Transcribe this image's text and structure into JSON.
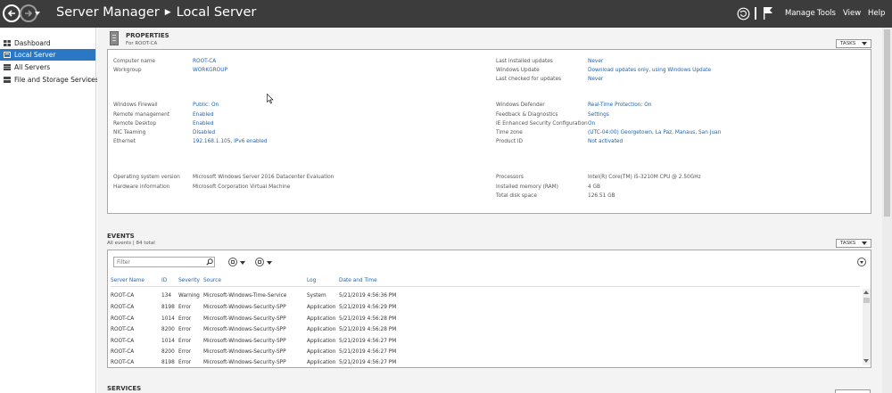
{
  "titlebar": {
    "app": "Server Manager",
    "page": "Local Server",
    "menu": [
      "Manage",
      "Tools",
      "View",
      "Help"
    ],
    "icons": {
      "back": "back-arrow-icon",
      "forward": "forward-arrow-icon",
      "refresh": "refresh-icon",
      "flag": "notification-flag-icon"
    }
  },
  "sidebar": {
    "items": [
      {
        "label": "Dashboard",
        "icon": "dashboard-icon"
      },
      {
        "label": "Local Server",
        "icon": "local-server-icon",
        "active": true
      },
      {
        "label": "All Servers",
        "icon": "all-servers-icon"
      },
      {
        "label": "File and Storage Services",
        "icon": "file-storage-icon",
        "arrow": "▷"
      }
    ]
  },
  "properties": {
    "title": "PROPERTIES",
    "subtitle": "For ROOT-CA",
    "tasks": "TASKS",
    "left": [
      {
        "label": "Computer name",
        "value": "ROOT-CA",
        "link": true
      },
      {
        "label": "Workgroup",
        "value": "WORKGROUP",
        "link": true
      },
      {
        "label": "Windows Firewall",
        "value": "Public: On",
        "link": true
      },
      {
        "label": "Remote management",
        "value": "Enabled",
        "link": true
      },
      {
        "label": "Remote Desktop",
        "value": "Enabled",
        "link": true
      },
      {
        "label": "NIC Teaming",
        "value": "Disabled",
        "link": true
      },
      {
        "label": "Ethernet",
        "value": "192.168.1.105, IPv6 enabled",
        "link": true
      },
      {
        "label": "Operating system version",
        "value": "Microsoft Windows Server 2016 Datacenter Evaluation",
        "link": false
      },
      {
        "label": "Hardware information",
        "value": "Microsoft Corporation Virtual Machine",
        "link": false
      }
    ],
    "right": [
      {
        "label": "Last installed updates",
        "value": "Never",
        "link": true
      },
      {
        "label": "Windows Update",
        "value": "Download updates only, using Windows Update",
        "link": true
      },
      {
        "label": "Last checked for updates",
        "value": "Never",
        "link": true
      },
      {
        "label": "Windows Defender",
        "value": "Real-Time Protection: On",
        "link": true
      },
      {
        "label": "Feedback & Diagnostics",
        "value": "Settings",
        "link": true
      },
      {
        "label": "IE Enhanced Security Configuration",
        "value": "On",
        "link": true
      },
      {
        "label": "Time zone",
        "value": "(UTC-04:00) Georgetown, La Paz, Manaus, San Juan",
        "link": true
      },
      {
        "label": "Product ID",
        "value": "Not activated",
        "link": true
      },
      {
        "label": "Processors",
        "value": "Intel(R) Core(TM) i5-3210M CPU @ 2.50GHz",
        "link": false
      },
      {
        "label": "Installed memory (RAM)",
        "value": "4 GB",
        "link": false
      },
      {
        "label": "Total disk space",
        "value": "126.51 GB",
        "link": false
      }
    ]
  },
  "events": {
    "title": "EVENTS",
    "subtitle": "All events | 84 total",
    "tasks": "TASKS",
    "filter_placeholder": "Filter",
    "columns": [
      "Server Name",
      "ID",
      "Severity",
      "Source",
      "Log",
      "Date and Time"
    ],
    "rows": [
      [
        "ROOT-CA",
        "134",
        "Warning",
        "Microsoft-Windows-Time-Service",
        "System",
        "5/21/2019 4:56:36 PM"
      ],
      [
        "ROOT-CA",
        "8198",
        "Error",
        "Microsoft-Windows-Security-SPP",
        "Application",
        "5/21/2019 4:56:29 PM"
      ],
      [
        "ROOT-CA",
        "1014",
        "Error",
        "Microsoft-Windows-Security-SPP",
        "Application",
        "5/21/2019 4:56:28 PM"
      ],
      [
        "ROOT-CA",
        "8200",
        "Error",
        "Microsoft-Windows-Security-SPP",
        "Application",
        "5/21/2019 4:56:28 PM"
      ],
      [
        "ROOT-CA",
        "1014",
        "Error",
        "Microsoft-Windows-Security-SPP",
        "Application",
        "5/21/2019 4:56:27 PM"
      ],
      [
        "ROOT-CA",
        "8200",
        "Error",
        "Microsoft-Windows-Security-SPP",
        "Application",
        "5/21/2019 4:56:27 PM"
      ],
      [
        "ROOT-CA",
        "8198",
        "Error",
        "Microsoft-Windows-Security-SPP",
        "Application",
        "5/21/2019 4:56:27 PM"
      ]
    ]
  },
  "services": {
    "title": "SERVICES"
  },
  "colors": {
    "titlebar": "#3c3c3c",
    "accent": "#2a77c4",
    "link": "#1e64b0"
  }
}
